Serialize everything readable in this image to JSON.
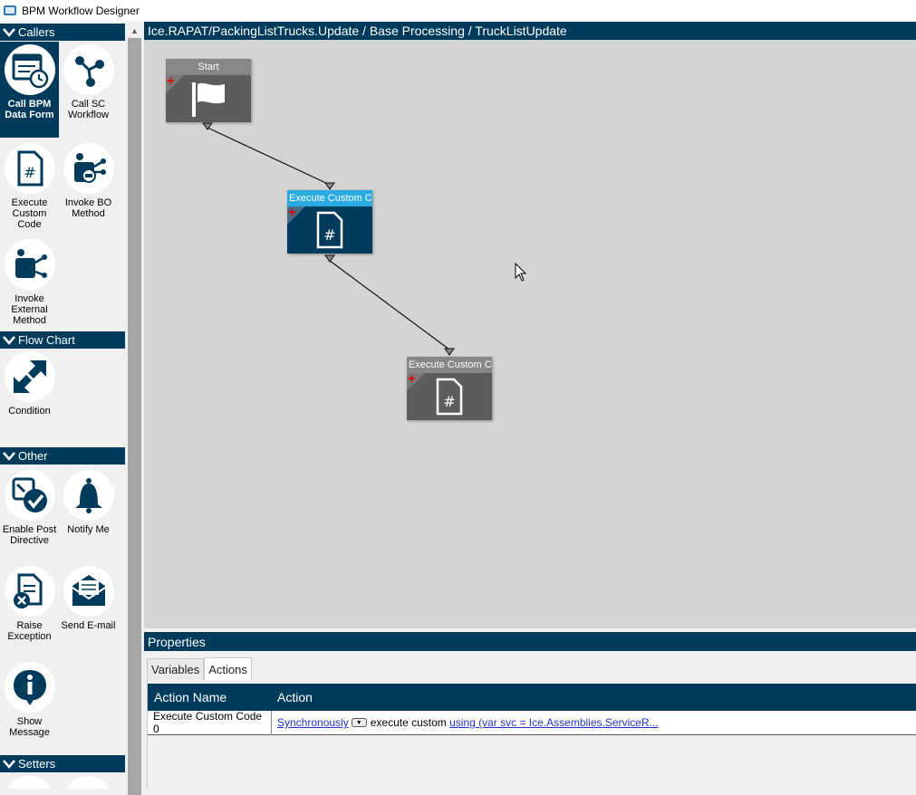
{
  "window": {
    "title": "BPM Workflow Designer"
  },
  "toolbox": {
    "groups": [
      {
        "name": "Callers",
        "items": [
          {
            "label": "Call BPM Data Form",
            "icon": "form-clock-icon",
            "selected": true
          },
          {
            "label": "Call SC Workflow",
            "icon": "workflow-nodes-icon"
          },
          {
            "label": "Execute Custom Code",
            "icon": "code-file-icon"
          },
          {
            "label": "Invoke BO Method",
            "icon": "bo-method-icon"
          },
          {
            "label": "Invoke External Method",
            "icon": "external-method-icon"
          }
        ]
      },
      {
        "name": "Flow Chart",
        "items": [
          {
            "label": "Condition",
            "icon": "condition-arrows-icon"
          }
        ]
      },
      {
        "name": "Other",
        "items": [
          {
            "label": "Enable Post Directive",
            "icon": "post-directive-icon"
          },
          {
            "label": "Notify Me",
            "icon": "bell-icon"
          },
          {
            "label": "Raise Exception",
            "icon": "exception-icon"
          },
          {
            "label": "Send E-mail",
            "icon": "envelope-icon"
          },
          {
            "label": "Show Message",
            "icon": "info-bubble-icon"
          }
        ]
      },
      {
        "name": "Setters",
        "items": []
      }
    ]
  },
  "designer": {
    "breadcrumb": "Ice.RAPAT/PackingListTrucks.Update / Base Processing / TruckListUpdate",
    "nodes": [
      {
        "title": "Start",
        "icon": "flag-icon"
      },
      {
        "title": "Execute Custom Co",
        "icon": "code-file-icon",
        "active": true
      },
      {
        "title": "Execute Custom Co",
        "icon": "code-file-icon"
      }
    ]
  },
  "properties": {
    "title": "Properties",
    "tabs": [
      "Variables",
      "Actions"
    ],
    "active_tab": "Actions",
    "columns": [
      "Action Name",
      "Action"
    ],
    "rows": [
      {
        "name": "Execute Custom Code 0",
        "mode": "Synchronously",
        "text": "execute custom",
        "code": "using (var svc = Ice.Assemblies.ServiceR..."
      }
    ]
  },
  "colors": {
    "header_bg": "#003b5c",
    "active_node_title": "#29abe2",
    "canvas_bg": "#d4d4d4",
    "node_bg": "#5d5d5d",
    "link": "#2233cc"
  }
}
